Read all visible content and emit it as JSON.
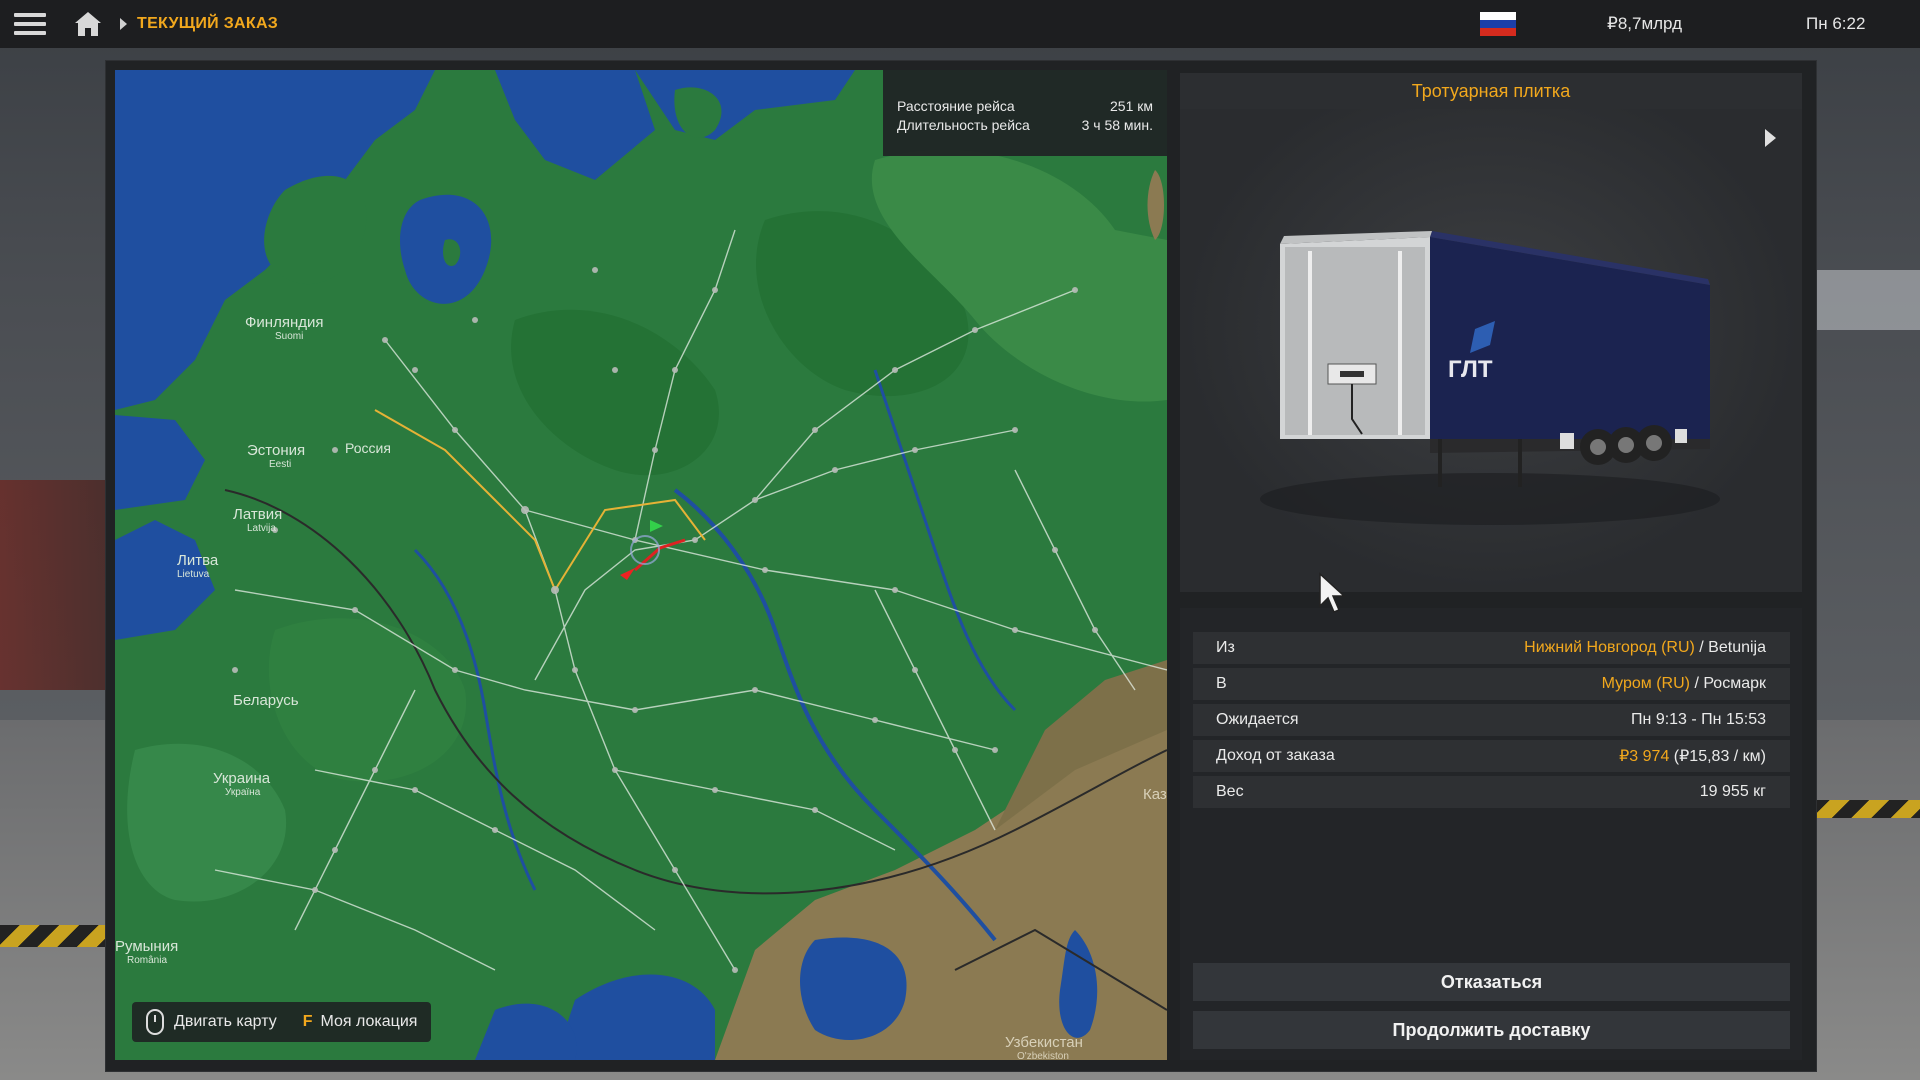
{
  "topbar": {
    "breadcrumb": "ТЕКУЩИЙ ЗАКАЗ",
    "money": "₽8,7млрд",
    "clock": "Пн 6:22",
    "flag_colors": [
      "#ffffff",
      "#1c3faa",
      "#d52b1e"
    ]
  },
  "route": {
    "distance_label": "Расстояние рейса",
    "distance_value": "251 км",
    "duration_label": "Длительность рейса",
    "duration_value": "3 ч 58 мин."
  },
  "map": {
    "labels": {
      "finland": "Финляндия",
      "finland_local": "Suomi",
      "estonia": "Эстония",
      "estonia_local": "Eesti",
      "latvia": "Латвия",
      "latvia_local": "Latvija",
      "lithuania": "Литва",
      "lithuania_local": "Lietuva",
      "russia": "Россия",
      "belarus": "Беларусь",
      "ukraine": "Украина",
      "ukraine_local": "Україна",
      "romania": "Румыния",
      "romania_local": "România",
      "kazakhstan_partial": "Каз",
      "uzbekistan": "Узбекистан",
      "uzbekistan_local": "O'zbekiston"
    },
    "controls": {
      "move_map": "Двигать карту",
      "my_location_key": "F",
      "my_location": "Моя локация"
    }
  },
  "cargo": {
    "title": "Тротуарная плитка",
    "trailer_brand": "ГЛТ"
  },
  "details": {
    "from_label": "Из",
    "from_city": "Нижний Новгород (RU)",
    "from_company": " / Betunija",
    "to_label": "В",
    "to_city": "Муром (RU)",
    "to_company": " / Росмарк",
    "expected_label": "Ожидается",
    "expected_value": "Пн 9:13 - Пн 15:53",
    "income_label": "Доход от заказа",
    "income_value": "₽3 974",
    "income_per_km": " (₽15,83 / км)",
    "weight_label": "Вес",
    "weight_value": "19 955 кг"
  },
  "buttons": {
    "decline": "Отказаться",
    "continue": "Продолжить доставку"
  },
  "colors": {
    "accent": "#f2a81d",
    "map_land": "#2b7a3e",
    "map_water": "#1f4fa0",
    "desert": "#8b7a52"
  }
}
